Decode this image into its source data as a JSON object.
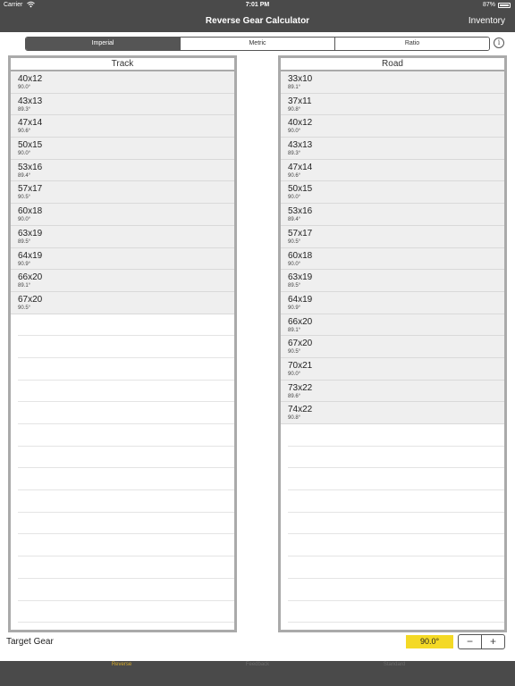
{
  "status": {
    "carrier": "Carrier",
    "time": "7:01 PM",
    "battery": "87%"
  },
  "nav": {
    "title": "Reverse Gear Calculator",
    "inventory": "Inventory"
  },
  "segments": [
    "Imperial",
    "Metric",
    "Ratio"
  ],
  "selected_segment": "Imperial",
  "track": {
    "header": "Track",
    "rows": [
      {
        "gear": "40x12",
        "deg": "90.0°"
      },
      {
        "gear": "43x13",
        "deg": "89.3°"
      },
      {
        "gear": "47x14",
        "deg": "90.6°"
      },
      {
        "gear": "50x15",
        "deg": "90.0°"
      },
      {
        "gear": "53x16",
        "deg": "89.4°"
      },
      {
        "gear": "57x17",
        "deg": "90.5°"
      },
      {
        "gear": "60x18",
        "deg": "90.0°"
      },
      {
        "gear": "63x19",
        "deg": "89.5°"
      },
      {
        "gear": "64x19",
        "deg": "90.9°"
      },
      {
        "gear": "66x20",
        "deg": "89.1°"
      },
      {
        "gear": "67x20",
        "deg": "90.5°"
      }
    ]
  },
  "road": {
    "header": "Road",
    "rows": [
      {
        "gear": "33x10",
        "deg": "89.1°"
      },
      {
        "gear": "37x11",
        "deg": "90.8°"
      },
      {
        "gear": "40x12",
        "deg": "90.0°"
      },
      {
        "gear": "43x13",
        "deg": "89.3°"
      },
      {
        "gear": "47x14",
        "deg": "90.6°"
      },
      {
        "gear": "50x15",
        "deg": "90.0°"
      },
      {
        "gear": "53x16",
        "deg": "89.4°"
      },
      {
        "gear": "57x17",
        "deg": "90.5°"
      },
      {
        "gear": "60x18",
        "deg": "90.0°"
      },
      {
        "gear": "63x19",
        "deg": "89.5°"
      },
      {
        "gear": "64x19",
        "deg": "90.9°"
      },
      {
        "gear": "66x20",
        "deg": "89.1°"
      },
      {
        "gear": "67x20",
        "deg": "90.5°"
      },
      {
        "gear": "70x21",
        "deg": "90.0°"
      },
      {
        "gear": "73x22",
        "deg": "89.6°"
      },
      {
        "gear": "74x22",
        "deg": "90.8°"
      }
    ]
  },
  "target": {
    "label": "Target Gear",
    "value": "90.0°"
  },
  "stepper": {
    "minus": "−",
    "plus": "+"
  },
  "tabs": [
    {
      "label": "Reverse",
      "active": true
    },
    {
      "label": "Feedback",
      "active": false
    },
    {
      "label": "Standard",
      "active": false
    }
  ],
  "icons": {
    "wifi": "wifi-icon",
    "battery": "battery-icon",
    "info": "info-icon"
  },
  "colors": {
    "bar": "#4a4a4a",
    "accent_yellow": "#f4d925",
    "active_tab": "#d4a92a",
    "row_bg": "#efefef",
    "panel_border": "#aaaaaa"
  }
}
